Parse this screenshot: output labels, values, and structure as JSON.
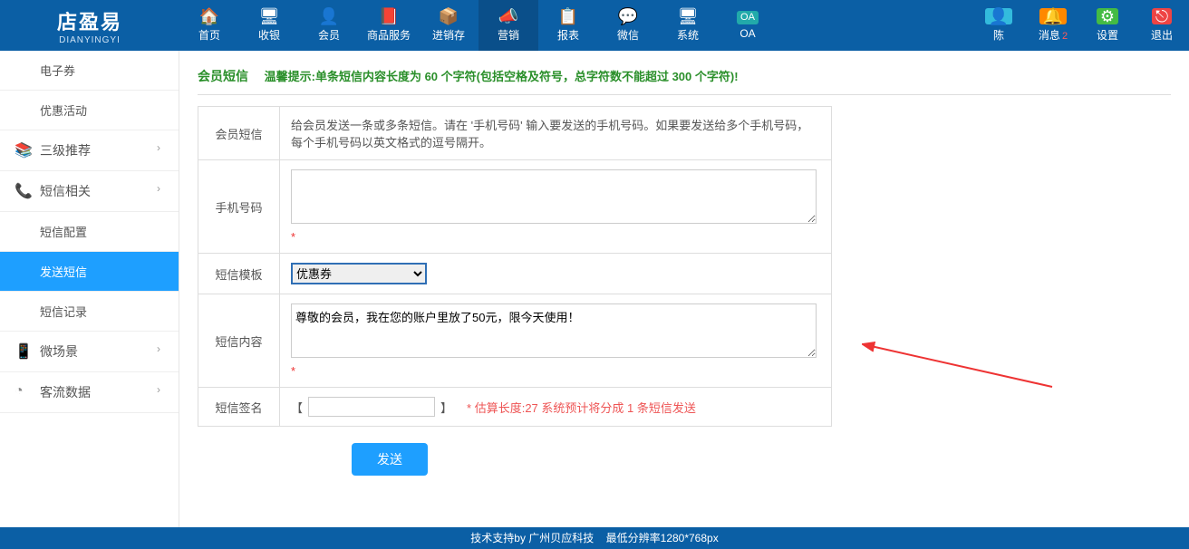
{
  "brand": {
    "name": "店盈易",
    "sub": "DIANYINGYI"
  },
  "nav": [
    {
      "label": "首页",
      "icon": "🏠"
    },
    {
      "label": "收银",
      "icon": "🖥"
    },
    {
      "label": "会员",
      "icon": "👤"
    },
    {
      "label": "商品服务",
      "icon": "📕"
    },
    {
      "label": "进销存",
      "icon": "📦"
    },
    {
      "label": "营销",
      "icon": "📣",
      "active": true
    },
    {
      "label": "报表",
      "icon": "📋"
    },
    {
      "label": "微信",
      "icon": "💬"
    },
    {
      "label": "系统",
      "icon": "🖥"
    },
    {
      "label": "OA",
      "icon": "OA"
    }
  ],
  "nav_right": [
    {
      "label": "陈",
      "icon": "👤"
    },
    {
      "label": "消息",
      "icon": "🔔",
      "badge": "2"
    },
    {
      "label": "设置",
      "icon": "⚙"
    },
    {
      "label": "退出",
      "icon": "⎋"
    }
  ],
  "sidebar": [
    {
      "label": "电子券",
      "type": "sub"
    },
    {
      "label": "优惠活动",
      "type": "sub"
    },
    {
      "label": "三级推荐",
      "icon": "📚",
      "icolor": "#2a9",
      "caret": "›"
    },
    {
      "label": "短信相关",
      "icon": "📞",
      "icolor": "#e33",
      "caret": "›"
    },
    {
      "label": "短信配置",
      "type": "sub"
    },
    {
      "label": "发送短信",
      "type": "sub",
      "active": true
    },
    {
      "label": "短信记录",
      "type": "sub"
    },
    {
      "label": "微场景",
      "icon": "📱",
      "icolor": "#37c",
      "caret": "›"
    },
    {
      "label": "客流数据",
      "icon": "◔",
      "icolor": "#888",
      "caret": "›"
    }
  ],
  "crumb": {
    "title": "会员短信",
    "tip": "温馨提示:单条短信内容长度为 60 个字符(包括空格及符号，总字符数不能超过 300 个字符)!"
  },
  "form": {
    "row1_label": "会员短信",
    "row1_desc": "给会员发送一条或多条短信。请在 '手机号码' 输入要发送的手机号码。如果要发送给多个手机号码，每个手机号码以英文格式的逗号隔开。",
    "row2_label": "手机号码",
    "row2_value": "",
    "row3_label": "短信模板",
    "row3_selected": "优惠券",
    "row4_label": "短信内容",
    "row4_value": "尊敬的会员，我在您的账户里放了50元，限今天使用！",
    "row5_label": "短信签名",
    "row5_prefix": "【",
    "row5_value": "",
    "row5_suffix": "】",
    "row5_note": "* 估算长度:27 系统预计将分成 1 条短信发送",
    "asterisk": "*"
  },
  "btn_send": "发送",
  "footer": {
    "left": "技术支持by 广州贝应科技",
    "right": "最低分辨率1280*768px"
  }
}
